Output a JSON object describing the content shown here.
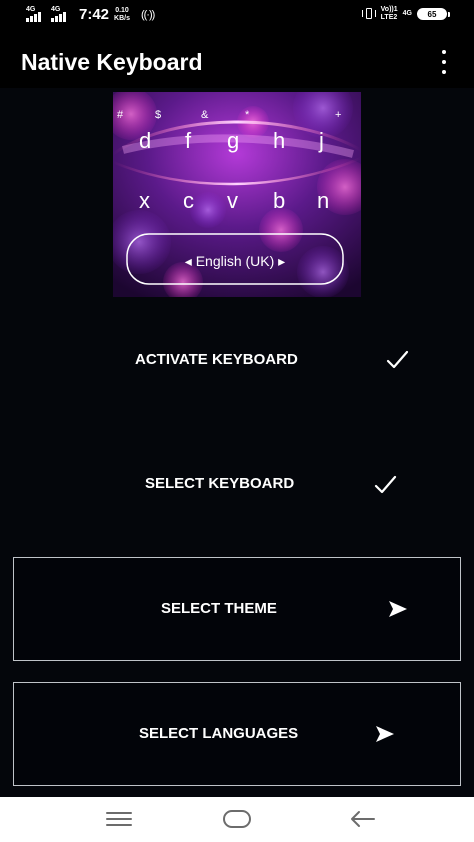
{
  "status_bar": {
    "sim1_network": "4G",
    "sim2_network": "4G",
    "time": "7:42",
    "speed_value": "0.10",
    "speed_unit": "KB/s",
    "hotspot": "((·))",
    "volte_top": "Vo))",
    "volte_bottom": "LTE2",
    "sim_slot": "1",
    "network_type": "4G",
    "battery_level": "65"
  },
  "app_bar": {
    "title": "Native Keyboard",
    "menu_icon": "overflow-menu-icon"
  },
  "keyboard_preview": {
    "symbols_row": [
      "#",
      "$",
      "&",
      "*",
      "+"
    ],
    "top_row": [
      "d",
      "f",
      "g",
      "h",
      "j"
    ],
    "bottom_row": [
      "x",
      "c",
      "v",
      "b",
      "n"
    ],
    "language_label": "◂ English (UK) ▸",
    "accent_colors": [
      "#ff2fd0",
      "#8a2be2",
      "#ff4fa0"
    ]
  },
  "options": {
    "activate": {
      "label": "ACTIVATE KEYBOARD",
      "icon": "check-icon"
    },
    "select_keyboard": {
      "label": "SELECT KEYBOARD",
      "icon": "check-icon"
    },
    "select_theme": {
      "label": "SELECT THEME",
      "icon": "arrow-right-icon"
    },
    "select_languages": {
      "label": "SELECT LANGUAGES",
      "icon": "arrow-right-icon"
    }
  },
  "nav_bar": {
    "menu_icon": "recents-icon",
    "home_icon": "home-icon",
    "back_icon": "back-icon"
  }
}
